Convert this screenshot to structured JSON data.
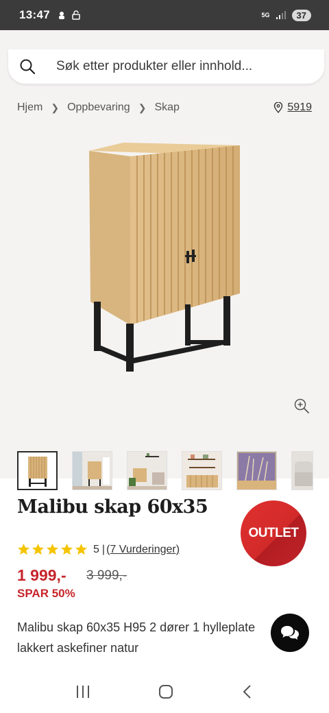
{
  "status_bar": {
    "time": "13:47",
    "network": "5G",
    "battery": "37"
  },
  "search": {
    "placeholder": "Søk etter produkter eller innhold..."
  },
  "breadcrumb": {
    "items": [
      "Hjem",
      "Oppbevaring",
      "Skap"
    ]
  },
  "store": {
    "code": "5919"
  },
  "product": {
    "title": "Malibu skap 60x35",
    "badge": "OUTLET",
    "rating_value": "5",
    "rating_separator": "|",
    "rating_link": "(7 Vurderinger)",
    "stars": 5,
    "price": "1 999,-",
    "old_price": "3 999,-",
    "savings": "SPAR 50%",
    "description_line1": "Malibu skap 60x35 H95 2 dører 1 hylleplate",
    "description_line2": "lakkert askefiner natur"
  },
  "colors": {
    "accent_red": "#c6252b",
    "star_yellow": "#f5c400",
    "status_bar": "#3b3b3b"
  },
  "icons": [
    "search-icon",
    "chevron-right-icon",
    "location-pin-icon",
    "zoom-in-icon",
    "chat-icon",
    "recent-apps-icon",
    "home-icon",
    "back-icon"
  ]
}
